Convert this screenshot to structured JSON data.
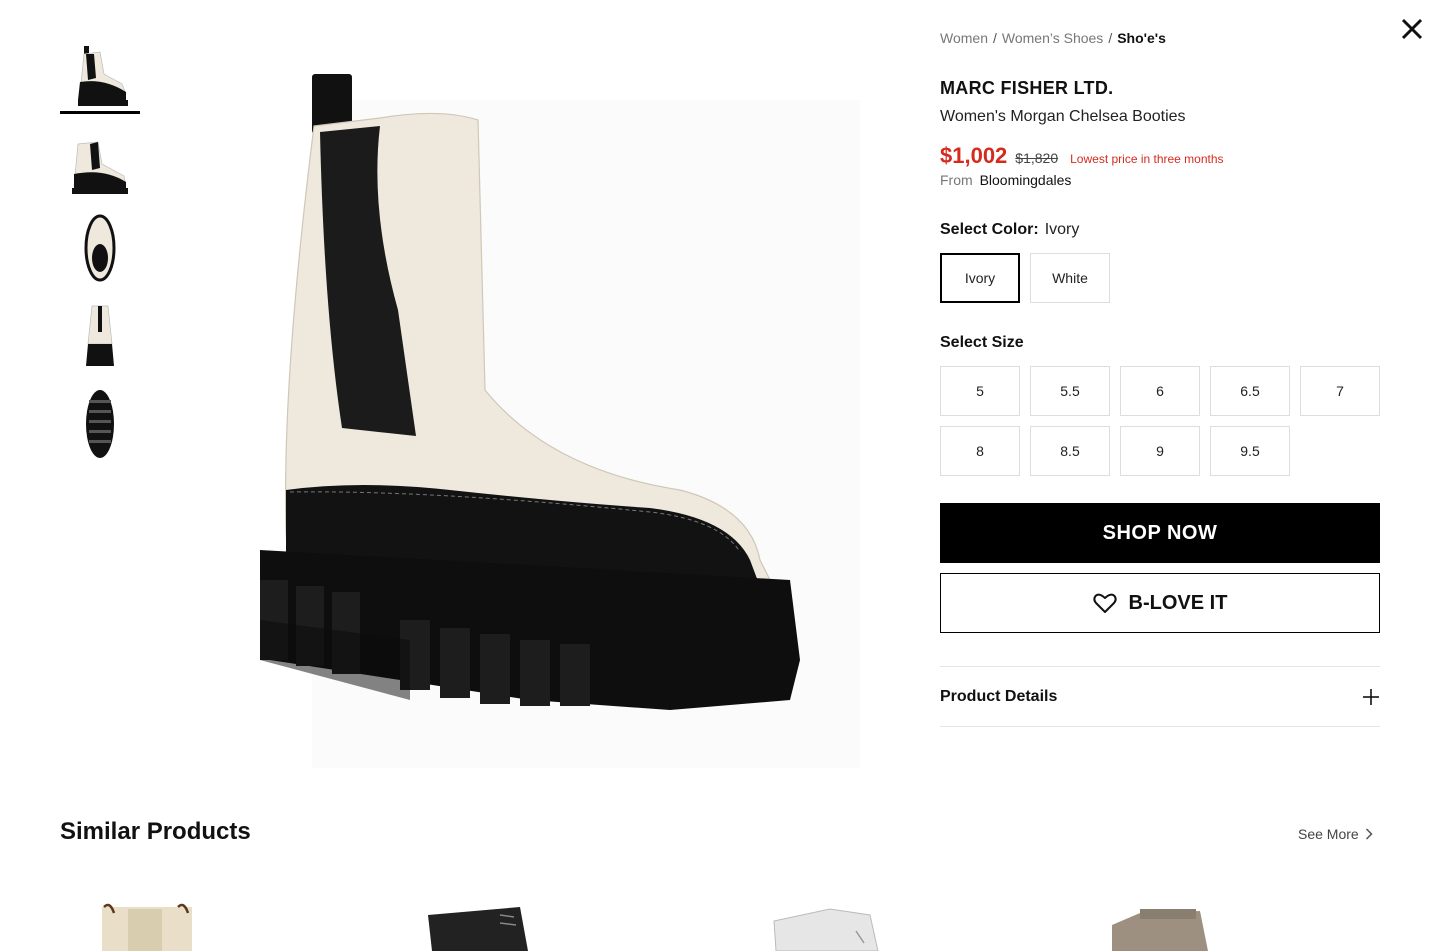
{
  "close": {
    "icon": "close-icon"
  },
  "breadcrumb": [
    "Women",
    "Women’s Shoes",
    "Sho'e's"
  ],
  "brand": "MARC FISHER LTD.",
  "product_name": "Women's Morgan Chelsea Booties",
  "price": {
    "sale": "$1,002",
    "original": "$1,820",
    "note": "Lowest price in three months"
  },
  "from": {
    "label": "From",
    "store": "Bloomingdales"
  },
  "color": {
    "label": "Select Color:",
    "selected": "Ivory",
    "options": [
      "Ivory",
      "White"
    ]
  },
  "size": {
    "label": "Select Size",
    "options": [
      "5",
      "5.5",
      "6",
      "6.5",
      "7",
      "8",
      "8.5",
      "9",
      "9.5"
    ]
  },
  "buttons": {
    "shop": "SHOP NOW",
    "love": "B-LOVE IT"
  },
  "details": {
    "label": "Product Details"
  },
  "similar": {
    "title": "Similar Products",
    "see_more": "See More"
  },
  "colors": {
    "sale_red": "#d52b1e",
    "black": "#000000"
  }
}
